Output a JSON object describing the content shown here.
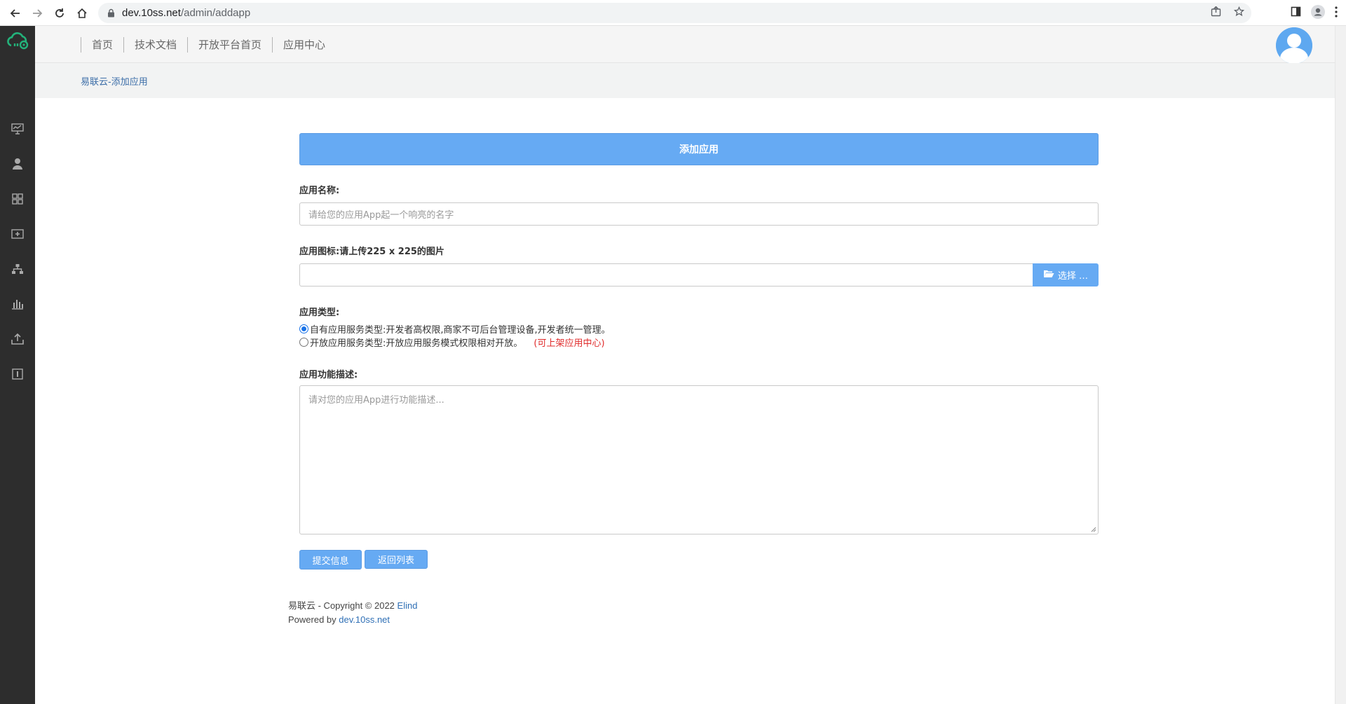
{
  "browser": {
    "url_host": "dev.10ss.net",
    "url_path": "/admin/addapp"
  },
  "topnav": {
    "links": [
      "首页",
      "技术文档",
      "开放平台首页",
      "应用中心"
    ]
  },
  "breadcrumb": "易联云-添加应用",
  "form": {
    "header": "添加应用",
    "name_label": "应用名称:",
    "name_placeholder": "请给您的应用App起一个响亮的名字",
    "icon_label": "应用图标:请上传225 x 225的图片",
    "choose_label": "选择 …",
    "type_label": "应用类型:",
    "type_options": [
      {
        "label": "自有应用服务类型:开发者高权限,商家不可后台管理设备,开发者统一管理。",
        "checked": true,
        "note": ""
      },
      {
        "label": "开放应用服务类型:开放应用服务模式权限相对开放。",
        "checked": false,
        "note": "(可上架应用中心)"
      }
    ],
    "desc_label": "应用功能描述:",
    "desc_placeholder": "请对您的应用App进行功能描述...",
    "submit_label": "提交信息",
    "back_label": "返回列表"
  },
  "footer": {
    "line1_prefix": "易联云 - Copyright © 2022 ",
    "line1_link": "Elind",
    "line2_prefix": "Powered by ",
    "line2_link": "dev.10ss.net"
  },
  "colors": {
    "primary": "#66aaf3",
    "sidebar": "#2d2d2d",
    "link": "#2f6fb5",
    "note": "#e02b2b"
  }
}
